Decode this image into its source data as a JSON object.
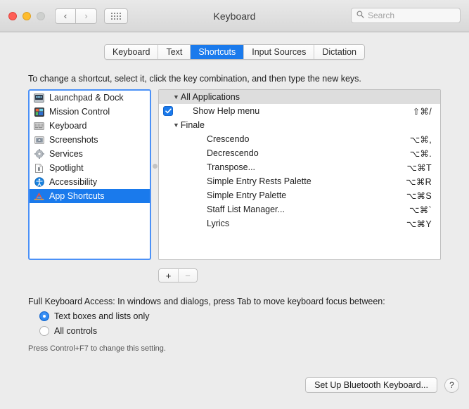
{
  "window": {
    "title": "Keyboard",
    "traffic_lights": [
      "close",
      "minimize",
      "zoom"
    ],
    "nav_back": "‹",
    "nav_forward": "›",
    "grid_icon": "show-all-icon"
  },
  "search": {
    "placeholder": "Search",
    "value": "",
    "icon": "search-icon"
  },
  "tabs": [
    {
      "label": "Keyboard",
      "active": false
    },
    {
      "label": "Text",
      "active": false
    },
    {
      "label": "Shortcuts",
      "active": true
    },
    {
      "label": "Input Sources",
      "active": false
    },
    {
      "label": "Dictation",
      "active": false
    }
  ],
  "instructions": "To change a shortcut, select it, click the key combination, and then type the new keys.",
  "sidebar": {
    "items": [
      {
        "label": "Launchpad & Dock",
        "icon": "launchpad-dock-icon",
        "selected": false
      },
      {
        "label": "Mission Control",
        "icon": "mission-control-icon",
        "selected": false
      },
      {
        "label": "Keyboard",
        "icon": "keyboard-icon",
        "selected": false
      },
      {
        "label": "Screenshots",
        "icon": "screenshots-icon",
        "selected": false
      },
      {
        "label": "Services",
        "icon": "services-gear-icon",
        "selected": false
      },
      {
        "label": "Spotlight",
        "icon": "spotlight-icon",
        "selected": false
      },
      {
        "label": "Accessibility",
        "icon": "accessibility-icon",
        "selected": false
      },
      {
        "label": "App Shortcuts",
        "icon": "app-store-icon",
        "selected": true
      }
    ]
  },
  "shortcuts": {
    "groups": [
      {
        "name": "All Applications",
        "header_style": "gray",
        "disclosure": "▼",
        "rows": [
          {
            "name": "Show Help menu",
            "keys": "⇧⌘/",
            "checked": true
          }
        ]
      },
      {
        "name": "Finale",
        "header_style": "plain",
        "disclosure": "▼",
        "rows": [
          {
            "name": "Crescendo",
            "keys": "⌥⌘,",
            "checked": false
          },
          {
            "name": "Decrescendo",
            "keys": "⌥⌘.",
            "checked": false
          },
          {
            "name": "Transpose...",
            "keys": "⌥⌘T",
            "checked": false
          },
          {
            "name": "Simple Entry Rests Palette",
            "keys": "⌥⌘R",
            "checked": false
          },
          {
            "name": "Simple Entry Palette",
            "keys": "⌥⌘S",
            "checked": false
          },
          {
            "name": "Staff List Manager...",
            "keys": "⌥⌘`",
            "checked": false
          },
          {
            "name": "Lyrics",
            "keys": "⌥⌘Y",
            "checked": false
          }
        ]
      }
    ]
  },
  "list_controls": {
    "add_label": "+",
    "remove_label": "−"
  },
  "full_keyboard_access": {
    "label": "Full Keyboard Access: In windows and dialogs, press Tab to move keyboard focus between:",
    "options": [
      {
        "label": "Text boxes and lists only",
        "selected": true
      },
      {
        "label": "All controls",
        "selected": false
      }
    ],
    "hint": "Press Control+F7 to change this setting."
  },
  "footer": {
    "bluetooth_button": "Set Up Bluetooth Keyboard...",
    "help_button": "?"
  },
  "colors": {
    "accent_blue": "#1a7aec",
    "focus_ring": "#4b91f7",
    "group_header_bg": "#dddddd",
    "window_bg": "#ececec"
  }
}
